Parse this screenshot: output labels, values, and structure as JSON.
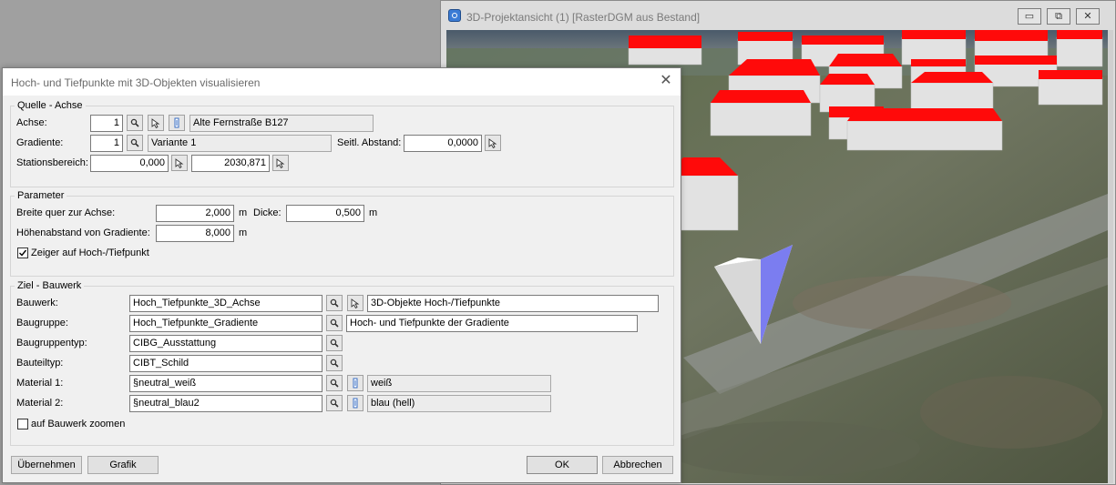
{
  "viewer": {
    "title": "3D-Projektansicht (1) [RasterDGM aus Bestand]",
    "min_label": "▭",
    "max_label": "⧉",
    "close_label": "✕"
  },
  "dialog": {
    "title": "Hoch- und Tiefpunkte mit 3D-Objekten visualisieren",
    "close_label": "✕",
    "quelle": {
      "legend": "Quelle - Achse",
      "achse_label": "Achse:",
      "achse_value": "1",
      "achse_name": "Alte Fernstraße B127",
      "gradiente_label": "Gradiente:",
      "gradiente_value": "1",
      "gradiente_name": "Variante 1",
      "seitl_label": "Seitl. Abstand:",
      "seitl_value": "0,0000",
      "stationsbereich_label": "Stationsbereich:",
      "station_from": "0,000",
      "station_to": "2030,871"
    },
    "parameter": {
      "legend": "Parameter",
      "breite_label": "Breite quer zur Achse:",
      "breite_value": "2,000",
      "breite_unit": "m",
      "dicke_label": "Dicke:",
      "dicke_value": "0,500",
      "dicke_unit": "m",
      "hoehe_label": "Höhenabstand von Gradiente:",
      "hoehe_value": "8,000",
      "hoehe_unit": "m",
      "zeiger_label": "Zeiger auf Hoch-/Tiefpunkt",
      "zeiger_checked": true
    },
    "ziel": {
      "legend": "Ziel - Bauwerk",
      "bauwerk_label": "Bauwerk:",
      "bauwerk_value": "Hoch_Tiefpunkte_3D_Achse",
      "bauwerk_desc": "3D-Objekte Hoch-/Tiefpunkte",
      "baugruppe_label": "Baugruppe:",
      "baugruppe_value": "Hoch_Tiefpunkte_Gradiente",
      "baugruppe_desc": "Hoch- und Tiefpunkte der Gradiente",
      "baugruppentyp_label": "Baugruppentyp:",
      "baugruppentyp_value": "CIBG_Ausstattung",
      "bauteiltyp_label": "Bauteiltyp:",
      "bauteiltyp_value": "CIBT_Schild",
      "material1_label": "Material 1:",
      "material1_value": "§neutral_weiß",
      "material1_desc": "weiß",
      "material2_label": "Material 2:",
      "material2_value": "§neutral_blau2",
      "material2_desc": "blau (hell)",
      "zoom_label": "auf Bauwerk zoomen",
      "zoom_checked": false
    },
    "buttons": {
      "uebernehmen": "Übernehmen",
      "grafik": "Grafik",
      "ok": "OK",
      "abbrechen": "Abbrechen"
    }
  }
}
